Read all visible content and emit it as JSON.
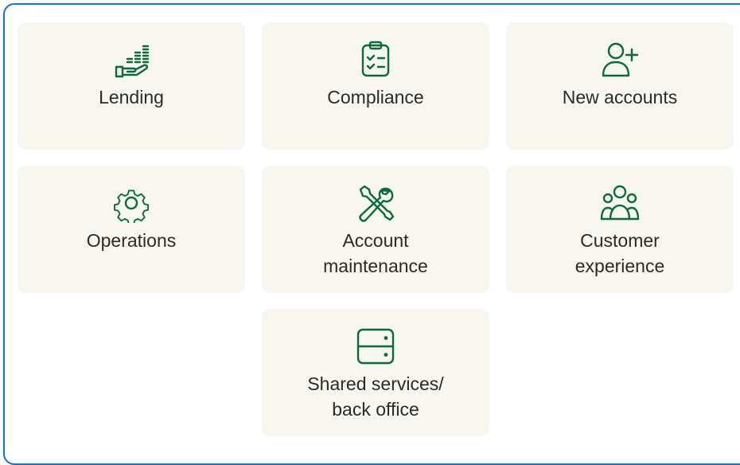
{
  "cards": [
    {
      "label": "Lending",
      "icon": "hand-coins-icon"
    },
    {
      "label": "Compliance",
      "icon": "clipboard-checklist-icon"
    },
    {
      "label": "New accounts",
      "icon": "user-plus-icon"
    },
    {
      "label": "Operations",
      "icon": "gear-icon"
    },
    {
      "label": "Account maintenance",
      "icon": "wrench-screwdriver-icon"
    },
    {
      "label": "Customer experience",
      "icon": "user-group-icon"
    },
    {
      "label": "Shared services/ back office",
      "icon": "server-icon"
    }
  ],
  "colors": {
    "accent": "#0b6a3a",
    "card_bg": "#f7f6f1",
    "frame_border": "#1a73c8",
    "text": "#2a2a2a"
  }
}
